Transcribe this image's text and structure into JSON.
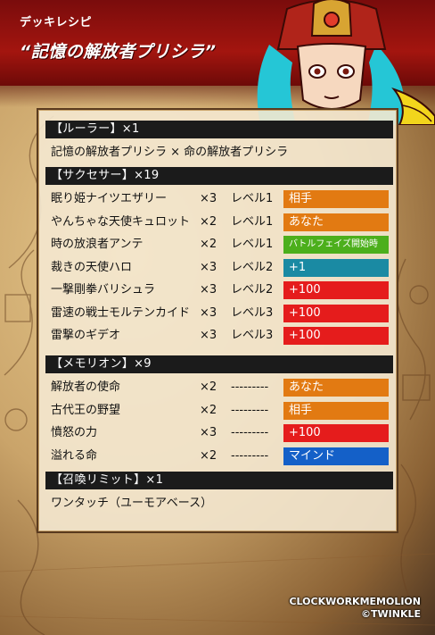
{
  "header": {
    "deck_label": "デッキレシピ",
    "deck_title": "“記憶の解放者プリシラ”"
  },
  "colors": {
    "orange": "#e27a12",
    "green": "#4caf1c",
    "teal": "#1a8aa3",
    "red": "#e51c1c",
    "blue": "#1460c8"
  },
  "sections": {
    "ruler": {
      "header": "【ルーラー】×1",
      "line": "記憶の解放者プリシラ × 命の解放者プリシラ"
    },
    "successor": {
      "header": "【サクセサー】×19",
      "rows": [
        {
          "name": "眠り姫ナイツエザリー",
          "qty": "×3",
          "level": "レベル1",
          "tag": "相手",
          "tag_color": "orange"
        },
        {
          "name": "やんちゃな天使キュロット",
          "qty": "×2",
          "level": "レベル1",
          "tag": "あなた",
          "tag_color": "orange"
        },
        {
          "name": "時の放浪者アンテ",
          "qty": "×2",
          "level": "レベル1",
          "tag": "バトルフェイズ開始時",
          "tag_color": "green"
        },
        {
          "name": "裁きの天使ハロ",
          "qty": "×3",
          "level": "レベル2",
          "tag": "+1",
          "tag_color": "teal"
        },
        {
          "name": "一撃剛拳バリシュラ",
          "qty": "×3",
          "level": "レベル2",
          "tag": "+100",
          "tag_color": "red"
        },
        {
          "name": "雷速の戦士モルテンカイド",
          "qty": "×3",
          "level": "レベル3",
          "tag": "+100",
          "tag_color": "red"
        },
        {
          "name": "雷撃のギデオ",
          "qty": "×3",
          "level": "レベル3",
          "tag": "+100",
          "tag_color": "red"
        }
      ]
    },
    "memorion": {
      "header": "【メモリオン】×9",
      "rows": [
        {
          "name": "解放者の使命",
          "qty": "×2",
          "level": "---------",
          "tag": "あなた",
          "tag_color": "orange"
        },
        {
          "name": "古代王の野望",
          "qty": "×2",
          "level": "---------",
          "tag": "相手",
          "tag_color": "orange"
        },
        {
          "name": "憤怒の力",
          "qty": "×3",
          "level": "---------",
          "tag": "+100",
          "tag_color": "red"
        },
        {
          "name": "溢れる命",
          "qty": "×2",
          "level": "---------",
          "tag": "マインド",
          "tag_color": "blue"
        }
      ]
    },
    "summon": {
      "header": "【召喚リミット】×1",
      "line": "ワンタッチ（ユーモアベース）"
    }
  },
  "credits": {
    "line1": "CLOCKWORKMEMOLION",
    "line2": "©TWINKLE"
  }
}
